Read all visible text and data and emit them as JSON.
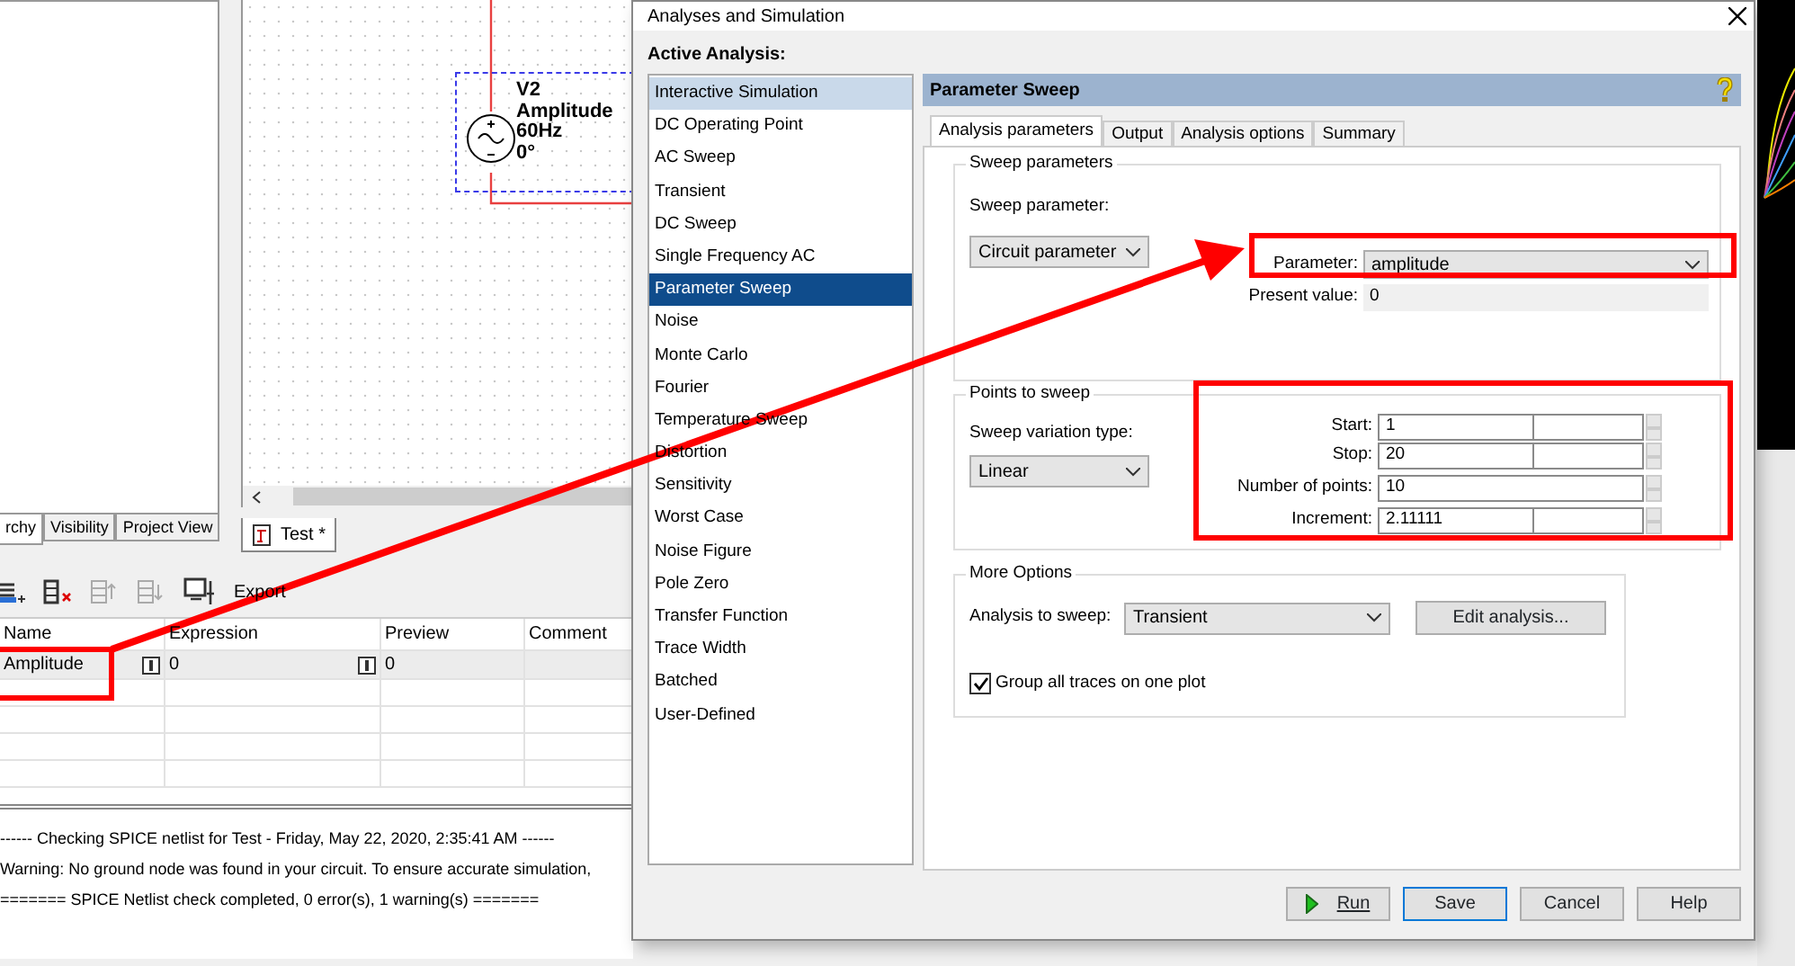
{
  "main_window": {
    "panel_tabs": [
      {
        "label": "rchy",
        "selected": true
      },
      {
        "label": "Visibility",
        "selected": false
      },
      {
        "label": "Project View",
        "selected": false
      }
    ],
    "component": {
      "name": "V2",
      "lines": [
        "Amplitude",
        "60Hz",
        "0°"
      ]
    },
    "document_tabs": [
      {
        "label": "Test *",
        "selected": true
      }
    ],
    "toolbar": {
      "export_label": "Export"
    },
    "parameter_table": {
      "columns": [
        "Name",
        "Expression",
        "Preview",
        "Comment"
      ],
      "rows": [
        {
          "name": "Amplitude",
          "expression": "0",
          "preview": "0"
        }
      ]
    },
    "output_lines": [
      "------ Checking SPICE netlist for Test - Friday, May 22, 2020, 2:35:41 AM ------",
      "Warning: No ground node was found in your circuit. To ensure accurate simulation,",
      "======= SPICE Netlist check completed, 0 error(s), 1 warning(s) ======="
    ]
  },
  "dialog": {
    "title": "Analyses and Simulation",
    "list_heading": "Active Analysis:",
    "analyses": [
      {
        "label": "Interactive Simulation",
        "selected": false,
        "highlighted": true
      },
      {
        "label": "DC Operating Point",
        "selected": false,
        "highlighted": false
      },
      {
        "label": "AC Sweep",
        "selected": false,
        "highlighted": false
      },
      {
        "label": "Transient",
        "selected": false,
        "highlighted": false
      },
      {
        "label": "DC Sweep",
        "selected": false,
        "highlighted": false
      },
      {
        "label": "Single Frequency AC",
        "selected": false,
        "highlighted": false
      },
      {
        "label": "Parameter Sweep",
        "selected": true,
        "highlighted": false
      },
      {
        "label": "Noise",
        "selected": false,
        "highlighted": false
      },
      {
        "label": "Monte Carlo",
        "selected": false,
        "highlighted": false
      },
      {
        "label": "Fourier",
        "selected": false,
        "highlighted": false
      },
      {
        "label": "Temperature Sweep",
        "selected": false,
        "highlighted": false
      },
      {
        "label": "Distortion",
        "selected": false,
        "highlighted": false
      },
      {
        "label": "Sensitivity",
        "selected": false,
        "highlighted": false
      },
      {
        "label": "Worst Case",
        "selected": false,
        "highlighted": false
      },
      {
        "label": "Noise Figure",
        "selected": false,
        "highlighted": false
      },
      {
        "label": "Pole Zero",
        "selected": false,
        "highlighted": false
      },
      {
        "label": "Transfer Function",
        "selected": false,
        "highlighted": false
      },
      {
        "label": "Trace Width",
        "selected": false,
        "highlighted": false
      },
      {
        "label": "Batched",
        "selected": false,
        "highlighted": false
      },
      {
        "label": "User-Defined",
        "selected": false,
        "highlighted": false
      }
    ],
    "panel_title": "Parameter Sweep",
    "tabs": [
      {
        "label": "Analysis parameters",
        "selected": true
      },
      {
        "label": "Output",
        "selected": false
      },
      {
        "label": "Analysis options",
        "selected": false
      },
      {
        "label": "Summary",
        "selected": false
      }
    ],
    "sweep_parameters": {
      "legend": "Sweep parameters",
      "type_label": "Sweep parameter:",
      "type_value": "Circuit parameter",
      "parameter_label": "Parameter:",
      "parameter_value": "amplitude",
      "present_value_label": "Present value:",
      "present_value": "0"
    },
    "points_to_sweep": {
      "legend": "Points to sweep",
      "variation_label": "Sweep variation type:",
      "variation_value": "Linear",
      "fields": [
        {
          "label": "Start:",
          "value": "1",
          "kind": "split"
        },
        {
          "label": "Stop:",
          "value": "20",
          "kind": "split"
        },
        {
          "label": "Number of points:",
          "value": "10",
          "kind": "single"
        },
        {
          "label": "Increment:",
          "value": "2.11111",
          "kind": "split"
        }
      ]
    },
    "more_options": {
      "legend": "More Options",
      "analysis_label": "Analysis to sweep:",
      "analysis_value": "Transient",
      "edit_button": "Edit analysis...",
      "group_traces": {
        "label": "Group all traces on one plot",
        "checked": true
      }
    },
    "buttons": [
      {
        "label": "Run",
        "kind": "run"
      },
      {
        "label": "Save",
        "kind": "default"
      },
      {
        "label": "Cancel",
        "kind": "plain"
      },
      {
        "label": "Help",
        "kind": "plain"
      }
    ]
  }
}
